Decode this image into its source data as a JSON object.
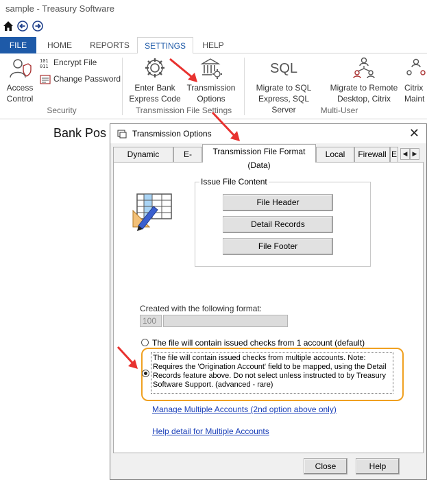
{
  "window": {
    "title": "sample - Treasury Software"
  },
  "menu_tabs": [
    "FILE",
    "HOME",
    "REPORTS",
    "SETTINGS",
    "HELP"
  ],
  "ribbon": {
    "security": {
      "label": "Security",
      "access_control": "Access Control",
      "encrypt_file": "Encrypt File",
      "change_password": "Change Password"
    },
    "transmission": {
      "label": "Transmission File Settings",
      "enter_bank_express_code": "Enter Bank Express Code",
      "transmission_options": "Transmission Options"
    },
    "multi_user": {
      "label": "Multi-User",
      "sql_icon_text": "SQL",
      "migrate_sql": "Migrate to SQL Express, SQL Server",
      "migrate_remote": "Migrate to Remote Desktop, Citrix",
      "citrix_maint": "Citrix Maint"
    }
  },
  "page_heading": "Bank Pos",
  "dialog": {
    "title": "Transmission Options",
    "close_glyph": "✕",
    "tabs": [
      "Dynamic Naming",
      "E-mail",
      "Transmission File Format (Data)",
      "Local File",
      "Firewall",
      "E"
    ],
    "active_tab": "Transmission File Format (Data)",
    "issue_file_content": {
      "legend": "Issue File Content",
      "buttons": [
        "File Header",
        "Detail Records",
        "File Footer"
      ]
    },
    "created_label": "Created with the following format:",
    "format_code": "100",
    "radio_single": "The file will contain issued checks from 1 account (default)",
    "radio_multi": "The file will contain issued checks from multiple accounts.  Note: Requires the 'Origination Account' field to be mapped, using the Detail Records feature above.  Do not select unless instructed to by Treasury Software Support. (advanced - rare)",
    "selected_option": "multi",
    "link_manage": "Manage Multiple Accounts (2nd option above only)",
    "link_help": "Help detail for Multiple Accounts",
    "close_button": "Close",
    "help_button": "Help"
  },
  "colors": {
    "accent_blue": "#1e5aa8",
    "highlight_orange": "#f0a020",
    "arrow_red": "#e8322f",
    "link_blue": "#1a3fb8"
  }
}
